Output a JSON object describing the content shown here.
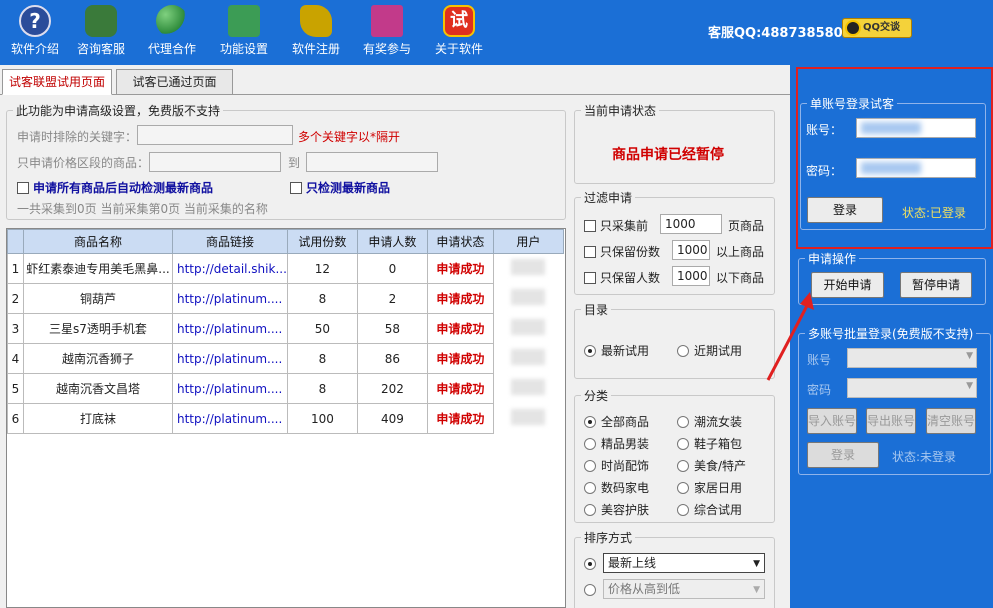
{
  "toolbar": {
    "items": [
      {
        "label": "软件介绍",
        "icon": "help-icon",
        "color": "#2b4c9a"
      },
      {
        "label": "咨询客服",
        "icon": "users-icon",
        "color": "#3a7a3a"
      },
      {
        "label": "代理合作",
        "icon": "network-icon",
        "color": "#2d8a3a"
      },
      {
        "label": "功能设置",
        "icon": "computer-icon",
        "color": "#3c9c55"
      },
      {
        "label": "软件注册",
        "icon": "key-icon",
        "color": "#c9a300"
      },
      {
        "label": "有奖参与",
        "icon": "gift-icon",
        "color": "#c23a8a"
      },
      {
        "label": "关于软件",
        "icon": "trial-icon",
        "color": "#e0301e",
        "glyph": "试"
      }
    ],
    "service": "客服QQ:488738580",
    "qq_button": "QQ交谈"
  },
  "tabs": [
    {
      "label": "试客联盟试用页面",
      "active": true
    },
    {
      "label": "试客已通过页面",
      "active": false
    }
  ],
  "settings": {
    "legend": "此功能为申请高级设置，免费版不支持",
    "exclude_label": "申请时排除的关键字：",
    "exclude_hint": "多个关键字以*隔开",
    "price_label": "只申请价格区段的商品：",
    "price_to": "到",
    "auto_detect": "申请所有商品后自动检测最新商品",
    "only_detect": "只检测最新商品",
    "collect_info": "一共采集到0页  当前采集第0页  当前采集的名称"
  },
  "grid": {
    "columns": [
      "商品名称",
      "商品链接",
      "试用份数",
      "申请人数",
      "申请状态",
      "用户"
    ],
    "rows": [
      {
        "n": "1",
        "name": "虾红素泰迪专用美毛黑鼻...",
        "link": "http://detail.shik...",
        "copies": "12",
        "applicants": "0",
        "status": "申请成功"
      },
      {
        "n": "2",
        "name": "铜葫芦",
        "link": "http://platinum....",
        "copies": "8",
        "applicants": "2",
        "status": "申请成功"
      },
      {
        "n": "3",
        "name": "三星s7透明手机套",
        "link": "http://platinum....",
        "copies": "50",
        "applicants": "58",
        "status": "申请成功"
      },
      {
        "n": "4",
        "name": "越南沉香狮子",
        "link": "http://platinum....",
        "copies": "8",
        "applicants": "86",
        "status": "申请成功"
      },
      {
        "n": "5",
        "name": "越南沉香文昌塔",
        "link": "http://platinum....",
        "copies": "8",
        "applicants": "202",
        "status": "申请成功"
      },
      {
        "n": "6",
        "name": "打底袜",
        "link": "http://platinum....",
        "copies": "100",
        "applicants": "409",
        "status": "申请成功"
      }
    ]
  },
  "status_box": {
    "legend": "当前申请状态",
    "text": "商品申请已经暂停"
  },
  "filter": {
    "legend": "过滤申请",
    "items": [
      {
        "label": "只采集前",
        "value": "1000",
        "suffix": "页商品"
      },
      {
        "label": "只保留份数",
        "value": "1000",
        "suffix": "以上商品"
      },
      {
        "label": "只保留人数",
        "value": "1000",
        "suffix": "以下商品"
      }
    ]
  },
  "catalog": {
    "legend": "目录",
    "options": [
      "最新试用",
      "近期试用"
    ],
    "selected": 0
  },
  "category": {
    "legend": "分类",
    "options": [
      "全部商品",
      "潮流女装",
      "精品男装",
      "鞋子箱包",
      "时尚配饰",
      "美食/特产",
      "数码家电",
      "家居日用",
      "美容护肤",
      "综合试用"
    ],
    "selected": 0
  },
  "sort": {
    "legend": "排序方式",
    "first": "最新上线",
    "second": "价格从高到低"
  },
  "single_login": {
    "legend": "单账号登录试客",
    "account_label": "账号：",
    "password_label": "密码：",
    "login_button": "登录",
    "status": "状态:已登录"
  },
  "apply_ops": {
    "legend": "申请操作",
    "start": "开始申请",
    "pause": "暂停申请"
  },
  "multi_login": {
    "legend": "多账号批量登录(免费版不支持)",
    "account_label": "账号",
    "password_label": "密码",
    "import": "导入账号",
    "export": "导出账号",
    "clear": "清空账号",
    "login_button": "登录",
    "status": "状态:未登录"
  },
  "colors": {
    "toolbar": "#1b6fd6",
    "status_red": "#d00000",
    "highlight": "#e02020"
  }
}
